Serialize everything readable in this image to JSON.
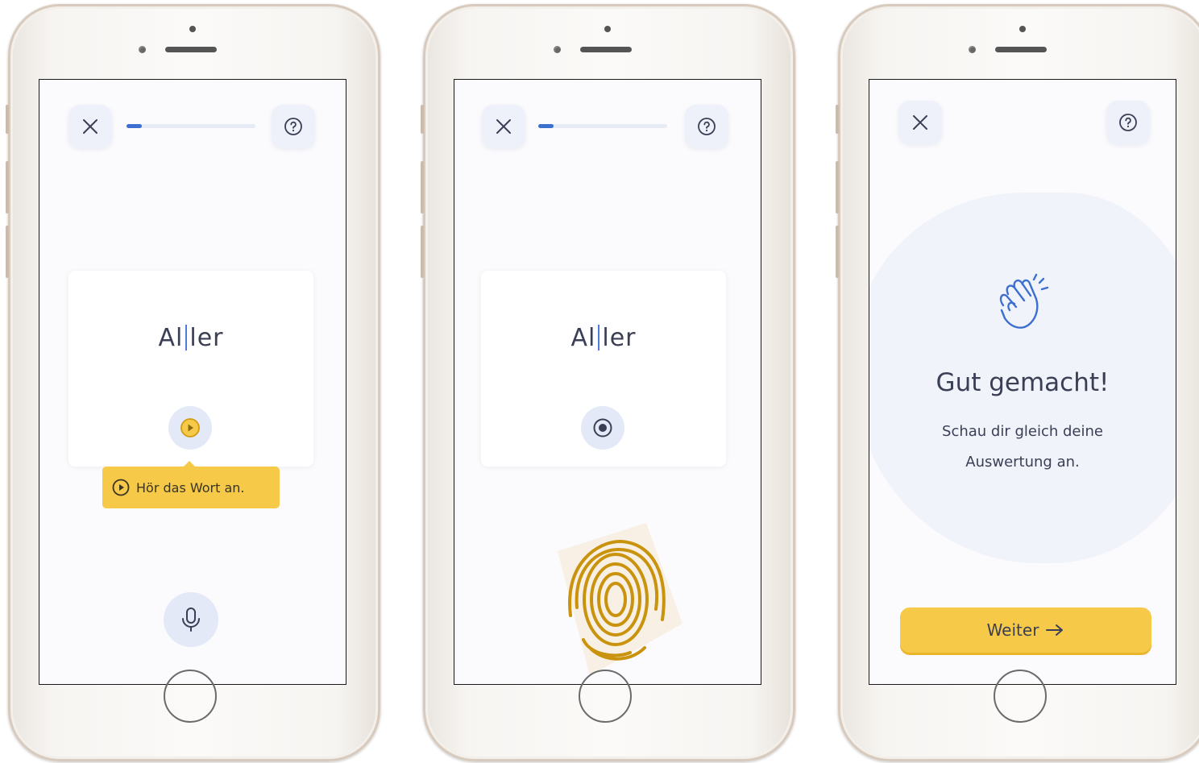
{
  "screens": [
    {
      "close_icon": "close-icon",
      "help_icon": "help-icon",
      "progress": 0.12,
      "word_left": "Al",
      "word_right": "ler",
      "play_icon": "play-icon",
      "tooltip": {
        "text": "Hör das Wort an.",
        "icon": "play-circle-icon"
      },
      "mic_icon": "microphone-icon"
    },
    {
      "close_icon": "close-icon",
      "help_icon": "help-icon",
      "progress": 0.12,
      "word_left": "Al",
      "word_right": "ler",
      "stop_icon": "stop-icon",
      "fingerprint_icon": "fingerprint-icon"
    },
    {
      "close_icon": "close-icon",
      "help_icon": "help-icon",
      "clap_icon": "clapping-hands-icon",
      "title": "Gut gemacht!",
      "subtitle_line1": "Schau dir gleich deine",
      "subtitle_line2": "Auswertung an.",
      "button_label": "Weiter",
      "arrow_icon": "arrow-right-icon"
    }
  ],
  "colors": {
    "accent_blue": "#3d6fd1",
    "accent_yellow": "#f7c948",
    "text_dark": "#3a3f56"
  }
}
